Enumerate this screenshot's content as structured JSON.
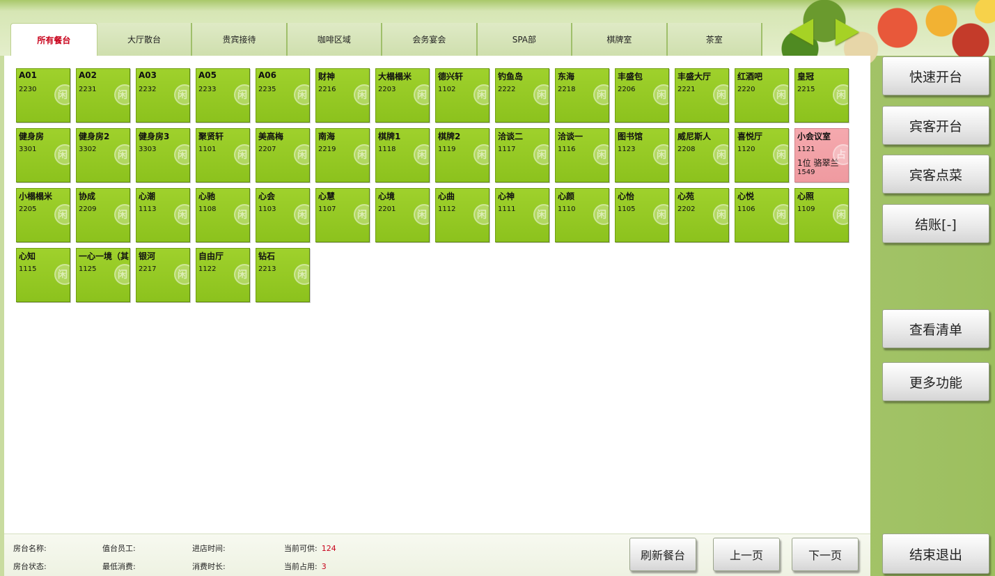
{
  "tabs": [
    {
      "label": "所有餐台",
      "active": true
    },
    {
      "label": "大厅散台",
      "active": false
    },
    {
      "label": "贵宾接待",
      "active": false
    },
    {
      "label": "咖啡区域",
      "active": false
    },
    {
      "label": "会务宴会",
      "active": false
    },
    {
      "label": "SPA部",
      "active": false
    },
    {
      "label": "棋牌室",
      "active": false
    },
    {
      "label": "茶室",
      "active": false
    }
  ],
  "tables": [
    {
      "name": "A01",
      "code": "2230"
    },
    {
      "name": "A02",
      "code": "2231"
    },
    {
      "name": "A03",
      "code": "2232"
    },
    {
      "name": "A05",
      "code": "2233"
    },
    {
      "name": "A06",
      "code": "2235"
    },
    {
      "name": "财神",
      "code": "2216"
    },
    {
      "name": "大榻榻米",
      "code": "2203"
    },
    {
      "name": "德兴轩",
      "code": "1102"
    },
    {
      "name": "钓鱼岛",
      "code": "2222"
    },
    {
      "name": "东海",
      "code": "2218"
    },
    {
      "name": "丰盛包",
      "code": "2206"
    },
    {
      "name": "丰盛大厅",
      "code": "2221"
    },
    {
      "name": "红酒吧",
      "code": "2220"
    },
    {
      "name": "皇冠",
      "code": "2215"
    },
    {
      "name": "健身房",
      "code": "3301"
    },
    {
      "name": "健身房2",
      "code": "3302"
    },
    {
      "name": "健身房3",
      "code": "3303"
    },
    {
      "name": "聚贤轩",
      "code": "1101"
    },
    {
      "name": "美高梅",
      "code": "2207"
    },
    {
      "name": "南海",
      "code": "2219"
    },
    {
      "name": "棋牌1",
      "code": "1118"
    },
    {
      "name": "棋牌2",
      "code": "1119"
    },
    {
      "name": "洽谈二",
      "code": "1117"
    },
    {
      "name": "洽谈一",
      "code": "1116"
    },
    {
      "name": "图书馆",
      "code": "1123"
    },
    {
      "name": "威尼斯人",
      "code": "2208"
    },
    {
      "name": "喜悦厅",
      "code": "1120"
    },
    {
      "name": "小会议室",
      "code": "1121",
      "occupied": true,
      "guests": "1位  骆翠兰",
      "extra": "1549"
    },
    {
      "name": "小榻榻米",
      "code": "2205"
    },
    {
      "name": "协成",
      "code": "2209"
    },
    {
      "name": "心潮",
      "code": "1113"
    },
    {
      "name": "心驰",
      "code": "1108"
    },
    {
      "name": "心会",
      "code": "1103"
    },
    {
      "name": "心慧",
      "code": "1107"
    },
    {
      "name": "心境",
      "code": "2201"
    },
    {
      "name": "心曲",
      "code": "1112"
    },
    {
      "name": "心神",
      "code": "1111"
    },
    {
      "name": "心颜",
      "code": "1110"
    },
    {
      "name": "心怡",
      "code": "1105"
    },
    {
      "name": "心苑",
      "code": "2202"
    },
    {
      "name": "心悦",
      "code": "1106"
    },
    {
      "name": "心照",
      "code": "1109"
    },
    {
      "name": "心知",
      "code": "1115"
    },
    {
      "name": "一心一境（其",
      "code": "1125"
    },
    {
      "name": "银河",
      "code": "2217"
    },
    {
      "name": "自由厅",
      "code": "1122"
    },
    {
      "name": "钻石",
      "code": "2213"
    }
  ],
  "seal": {
    "free": "闲",
    "occupied": "占"
  },
  "side_buttons": [
    "快速开台",
    "宾客开台",
    "宾客点菜",
    "结账[-]",
    "查看清单",
    "更多功能",
    "结束退出"
  ],
  "status": {
    "room_name_label": "房台名称:",
    "room_status_label": "房台状态:",
    "staff_label": "值台员工:",
    "min_spend_label": "最低消费:",
    "enter_time_label": "进店时间:",
    "duration_label": "消费时长:",
    "available_label": "当前可供:",
    "available_value": "124",
    "occupied_label": "当前占用:",
    "occupied_value": "3"
  },
  "bottom_buttons": {
    "refresh": "刷新餐台",
    "prev": "上一页",
    "next": "下一页"
  },
  "colors": {
    "free": "#9acd28",
    "occupied": "#f2a1a6",
    "active_tab_text": "#c8001a"
  }
}
